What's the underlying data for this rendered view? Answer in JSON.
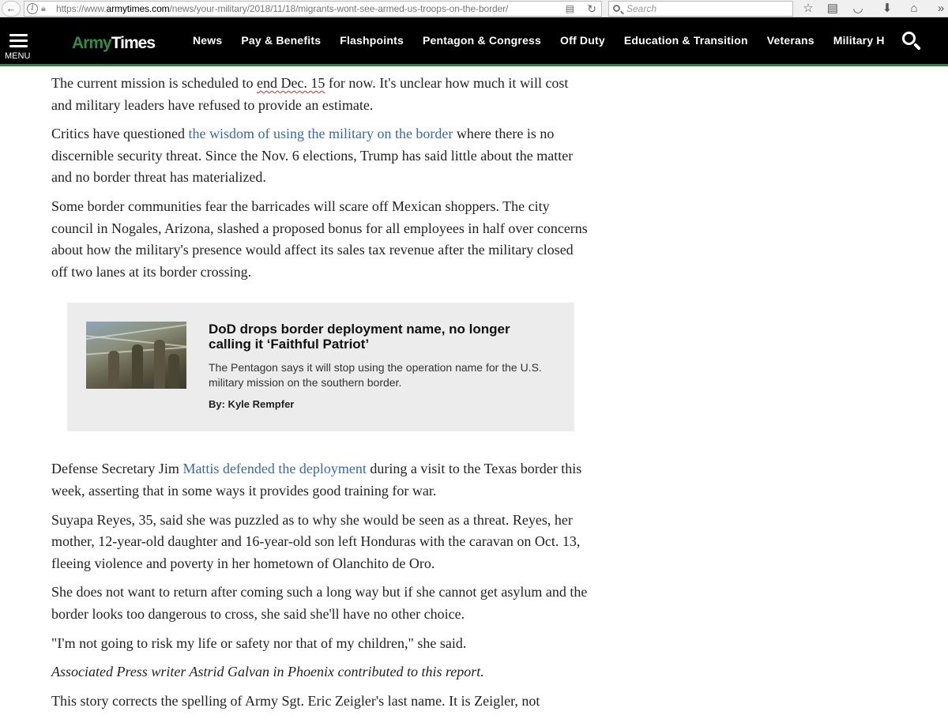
{
  "browser": {
    "back_glyph": "←",
    "url_prefix": "https://www.",
    "url_host": "armytimes.com",
    "url_path": "/news/your-military/2018/11/18/migrants-wont-see-armed-us-troops-on-the-border/",
    "search_placeholder": "Search"
  },
  "header": {
    "menu_label": "MENU",
    "logo_army": "Army",
    "logo_times": "Times",
    "nav": [
      "News",
      "Pay & Benefits",
      "Flashpoints",
      "Pentagon & Congress",
      "Off Duty",
      "Education & Transition",
      "Veterans",
      "Military H"
    ],
    "accent_color": "#2c8a3f"
  },
  "article": {
    "p1_before": "The current mission is scheduled to ",
    "p1_mark": "end Dec. 15",
    "p1_after": " for now. It's unclear how much it will cost and military leaders have refused to provide an estimate.",
    "p2_before": "Critics have questioned ",
    "p2_link": "the wisdom of using the military on the border",
    "p2_after": " where there is no discernible security threat. Since the Nov. 6 elections, Trump has said little about the matter and no border threat has materialized.",
    "p3": "Some border communities fear the barricades will scare off Mexican shoppers. The city council in Nogales, Arizona, slashed a proposed bonus for all employees in half over concerns about how the military's presence would affect its sales tax revenue after the military closed off two lanes at its border crossing.",
    "related": {
      "title": "DoD drops border deployment name, no longer calling it ‘Faithful Patriot’",
      "summary": "The Pentagon says it will stop using the operation name for the U.S. military mission on the southern border.",
      "byline": "By: Kyle Rempfer"
    },
    "p4_before": "Defense Secretary Jim ",
    "p4_link": "Mattis defended the deployment",
    "p4_after": " during a visit to the Texas border this week, asserting that in some ways it provides good training for war.",
    "p5": "Suyapa Reyes, 35, said she was puzzled as to why she would be seen as a threat. Reyes, her mother, 12-year-old daughter and 16-year-old son left Honduras with the caravan on Oct. 13, fleeing violence and poverty in her hometown of Olanchito de Oro.",
    "p6": "She does not want to return after coming such a long way but if she cannot get asylum and the border looks too dangerous to cross, she said she'll have no other choice.",
    "p7": "\"I'm not going to risk my life or safety nor that of my children,\" she said.",
    "p8": "Associated Press writer Astrid Galvan in Phoenix contributed to this report.",
    "p9": "This story corrects the spelling of Army Sgt. Eric Zeigler's last name. It is Zeigler, not"
  }
}
